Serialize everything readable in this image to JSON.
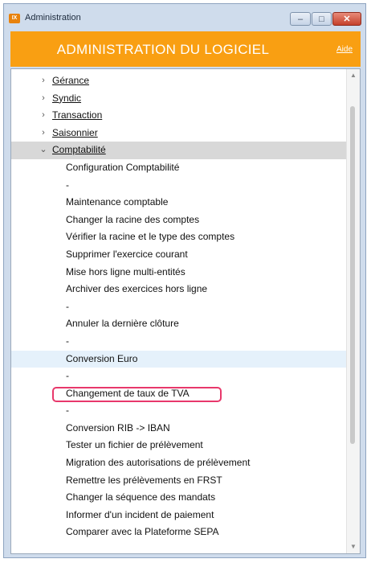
{
  "window": {
    "title": "Administration",
    "icon_text": "IX",
    "controls": {
      "minimize": "–",
      "maximize": "□",
      "close": "✕"
    }
  },
  "header": {
    "title": "ADMINISTRATION DU LOGICIEL",
    "help": "Aide"
  },
  "tree": {
    "groups": [
      {
        "label": "Gérance",
        "expanded": false
      },
      {
        "label": "Syndic",
        "expanded": false
      },
      {
        "label": "Transaction",
        "expanded": false
      },
      {
        "label": "Saisonnier",
        "expanded": false
      },
      {
        "label": "Comptabilité",
        "expanded": true
      }
    ],
    "arrows": {
      "collapsed": "›",
      "expanded": "⌄"
    },
    "children": [
      "Configuration Comptabilité",
      "-",
      "Maintenance comptable",
      "Changer la racine des comptes",
      "Vérifier la racine et le type des comptes",
      "Supprimer l'exercice courant",
      "Mise hors ligne multi-entités",
      "Archiver des exercices hors ligne",
      "-",
      "Annuler la dernière clôture",
      "-",
      "Conversion Euro",
      "-",
      "Changement de taux de TVA",
      "-",
      "Conversion RIB -> IBAN",
      "Tester un fichier de prélèvement",
      "Migration des autorisations de prélèvement",
      "Remettre les prélèvements en FRST",
      "Changer la séquence des mandats",
      "Informer d'un incident de paiement",
      "Comparer avec la Plateforme SEPA"
    ]
  },
  "scrollbar": {
    "up": "▲",
    "down": "▼"
  }
}
